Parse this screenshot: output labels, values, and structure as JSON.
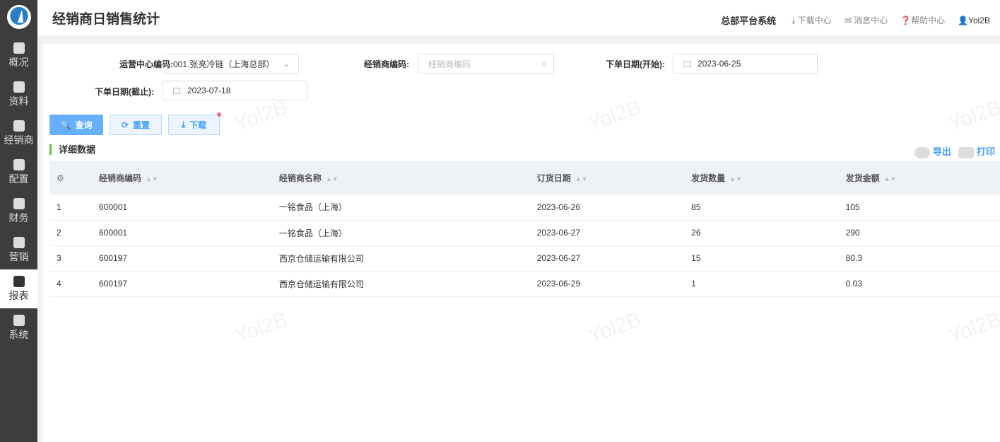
{
  "sidebar": {
    "items": [
      "概况",
      "资料",
      "经销商",
      "配置",
      "财务",
      "营销",
      "报表",
      "系统"
    ],
    "active": 6
  },
  "header": {
    "title": "经销商日销售统计",
    "system": "总部平台系统",
    "download_center": "下载中心",
    "message_center": "消息中心",
    "help_center": "帮助中心",
    "user": "Yol2B"
  },
  "filters": {
    "ops_center_label": "运营中心编码:",
    "ops_center_value": "001.张亮冷链（上海总部）",
    "dealer_label": "经销商编码:",
    "dealer_placeholder": "经销商编码",
    "start_label": "下单日期(开始):",
    "start_value": "2023-06-25",
    "end_label": "下单日期(截止):",
    "end_value": "2023-07-18"
  },
  "buttons": {
    "query": "查询",
    "reset": "重置",
    "download": "下载",
    "export": "导出",
    "print": "打印"
  },
  "section_title": "详细数据",
  "watermark": "Yol2B",
  "table": {
    "columns": [
      "经销商编码",
      "经销商名称",
      "订货日期",
      "发货数量",
      "发货金额"
    ],
    "rows": [
      [
        "1",
        "600001",
        "一铭食品（上海）",
        "2023-06-26",
        "85",
        "105"
      ],
      [
        "2",
        "600001",
        "一铭食品（上海）",
        "2023-06-27",
        "26",
        "290"
      ],
      [
        "3",
        "600197",
        "西京仓储运输有限公司",
        "2023-06-27",
        "15",
        "80.3"
      ],
      [
        "4",
        "600197",
        "西京仓储运输有限公司",
        "2023-06-29",
        "1",
        "0.03"
      ]
    ]
  }
}
